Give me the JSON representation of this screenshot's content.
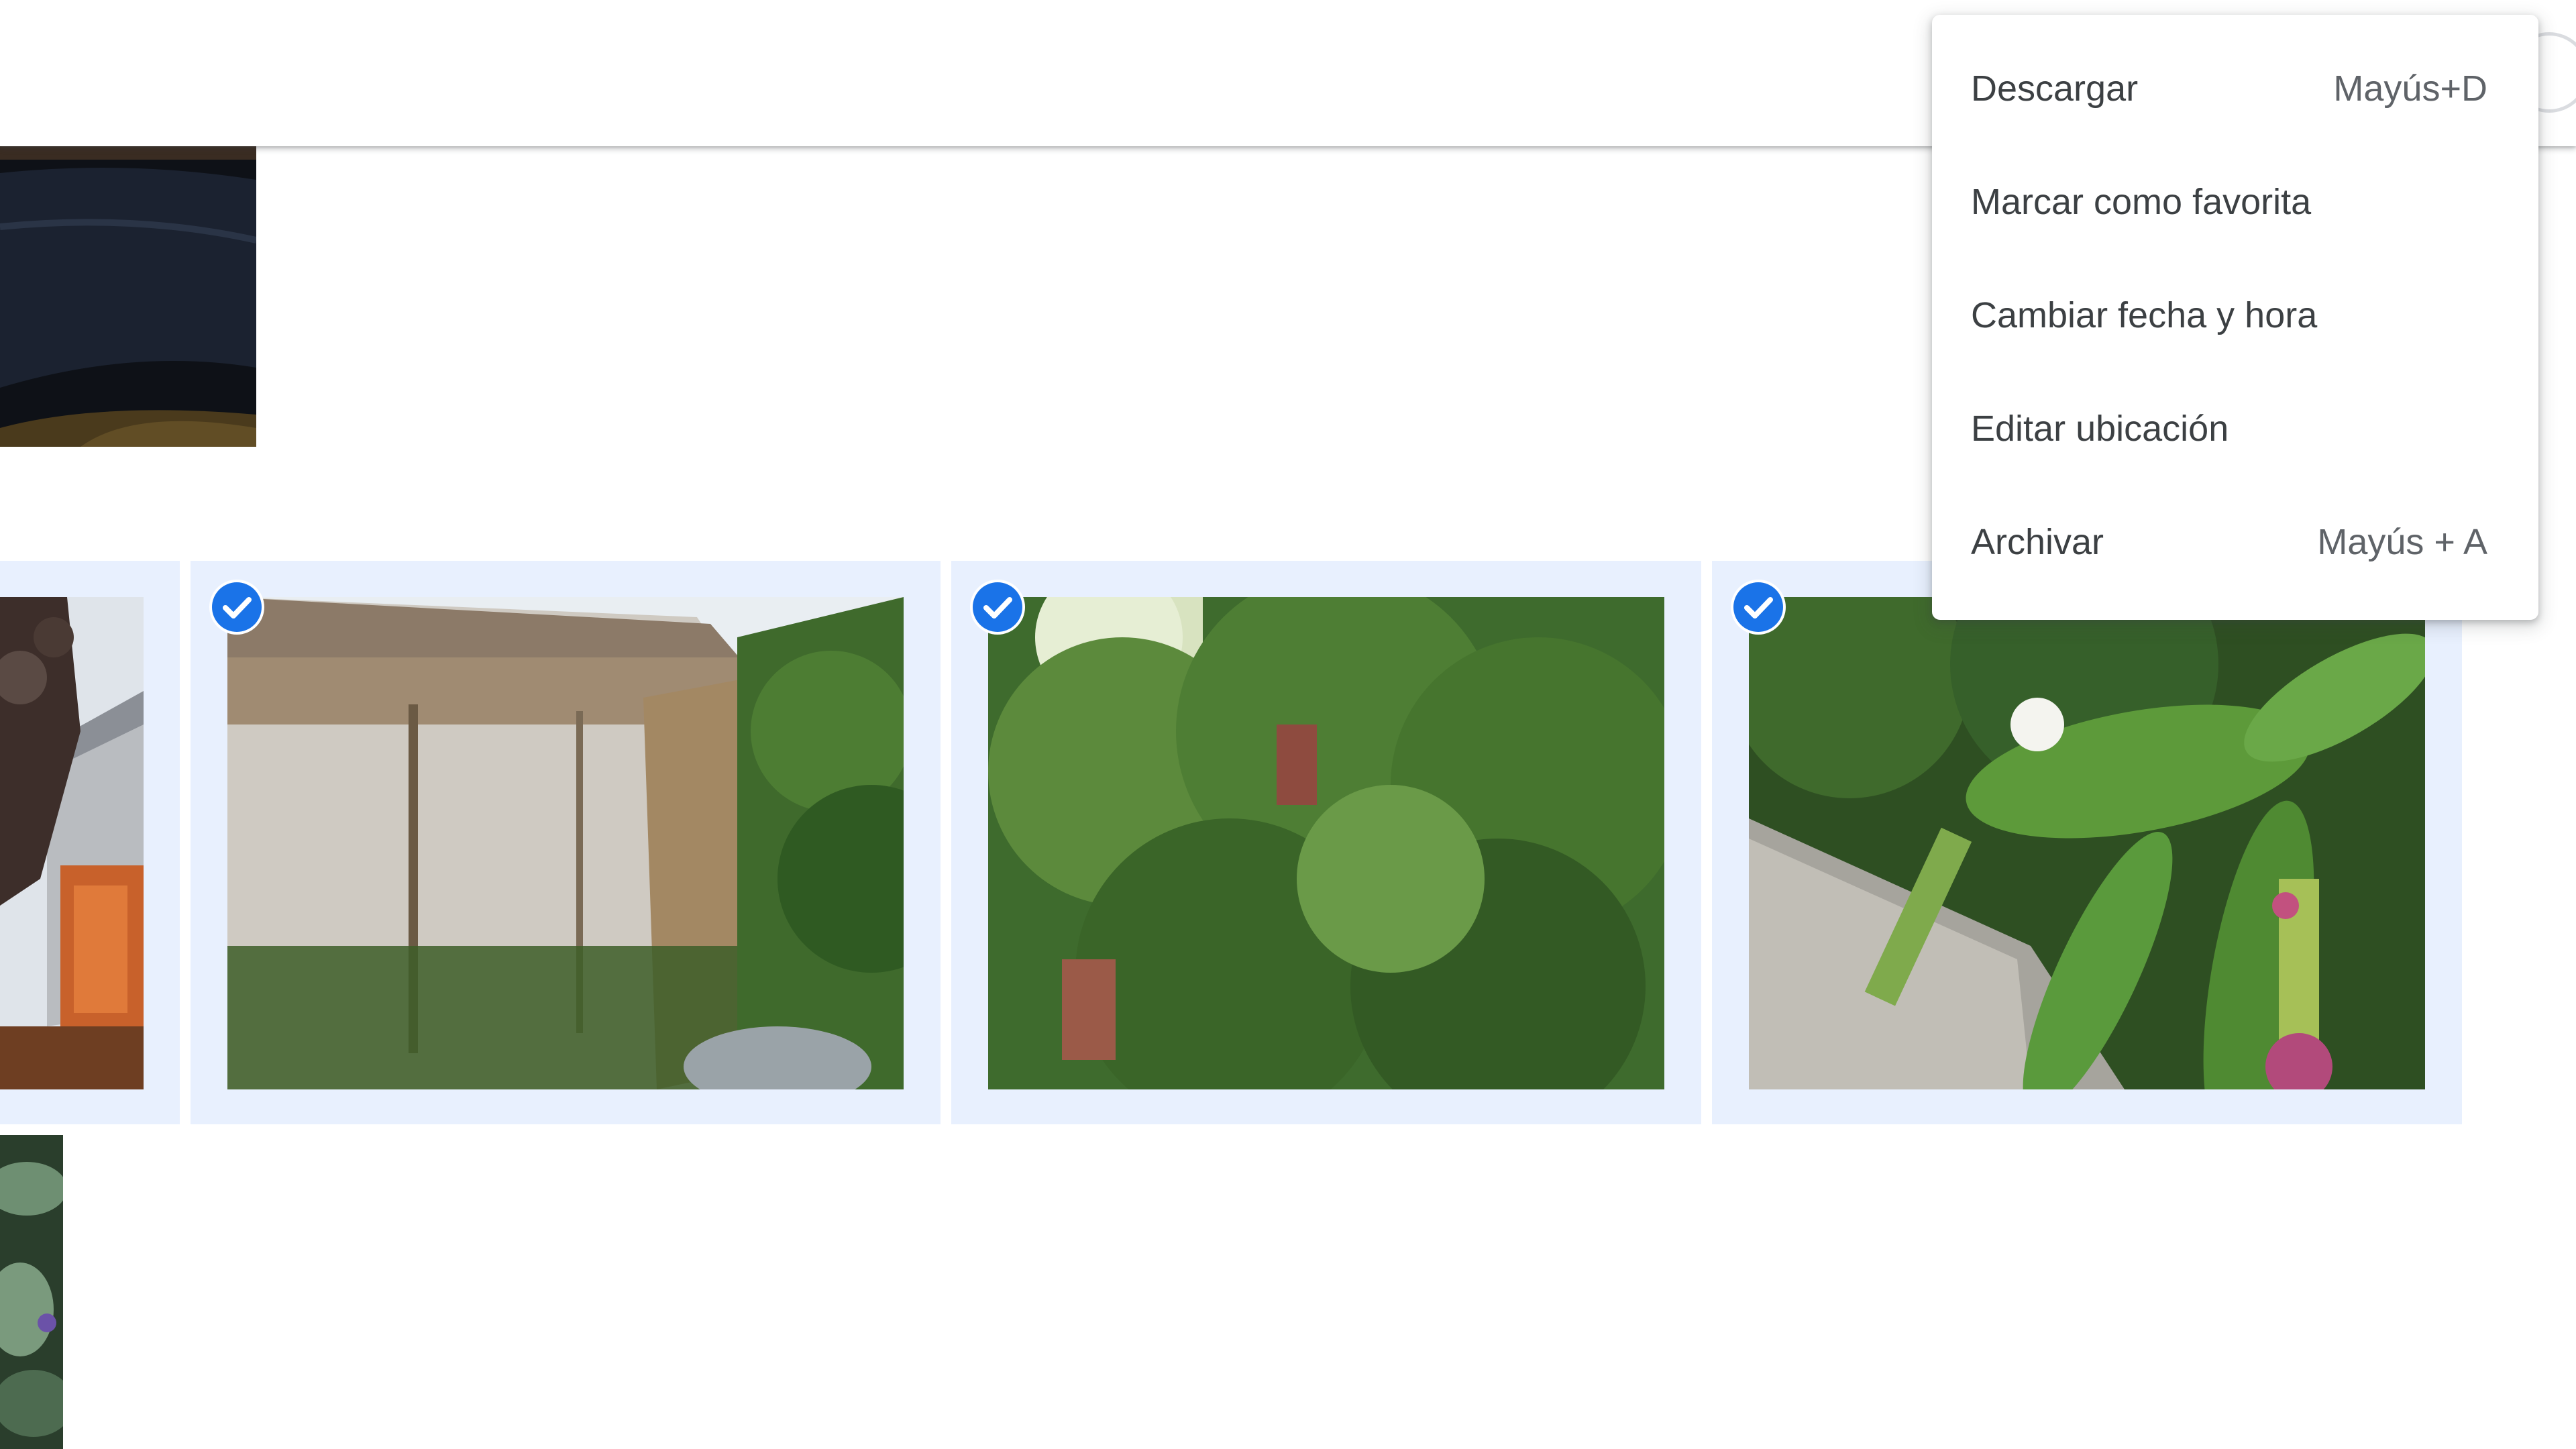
{
  "context_menu": {
    "items": [
      {
        "label": "Descargar",
        "shortcut": "Mayús+D"
      },
      {
        "label": "Marcar como favorita",
        "shortcut": ""
      },
      {
        "label": "Cambiar fecha y hora",
        "shortcut": ""
      },
      {
        "label": "Editar ubicación",
        "shortcut": ""
      },
      {
        "label": "Archivar",
        "shortcut": "Mayús + A"
      }
    ]
  },
  "photos": {
    "selected_count": 3,
    "accent_color": "#1a73e8",
    "selection_bg_color": "#e8f0fe"
  }
}
